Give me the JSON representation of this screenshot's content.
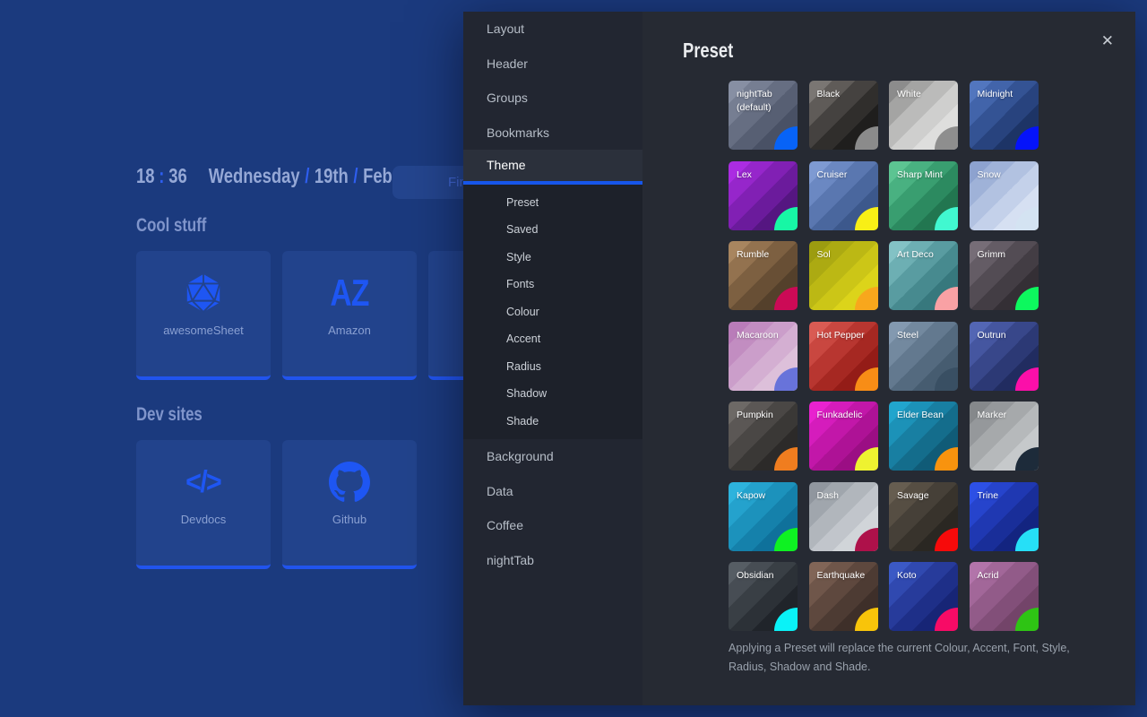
{
  "colors": {
    "page_background": "#1b3a7e",
    "page_accent": "#2154ee",
    "modal_accent": "#1656ea",
    "modal_sidebar_bg": "#222631",
    "modal_panel_bg": "#262a33"
  },
  "page": {
    "clock": {
      "hours": "18",
      "separator": ":",
      "minutes": "36",
      "day": "Wednesday",
      "date": "19th",
      "month": "February",
      "slash": "/"
    },
    "search": {
      "placeholder": "Find"
    },
    "groups": [
      {
        "title": "Cool stuff",
        "bookmarks": [
          {
            "label": "awesomeSheet",
            "icon": "d20-icon"
          },
          {
            "label": "Amazon",
            "icon": "az-letters-icon"
          },
          {
            "label": "",
            "icon": "none"
          }
        ]
      },
      {
        "title": "Dev sites",
        "bookmarks": [
          {
            "label": "Devdocs",
            "icon": "code-brackets-icon"
          },
          {
            "label": "Github",
            "icon": "github-icon"
          }
        ]
      }
    ]
  },
  "settings": {
    "menu": [
      {
        "label": "Layout"
      },
      {
        "label": "Header"
      },
      {
        "label": "Groups"
      },
      {
        "label": "Bookmarks"
      },
      {
        "label": "Theme",
        "active": true,
        "children": [
          "Preset",
          "Saved",
          "Style",
          "Fonts",
          "Colour",
          "Accent",
          "Radius",
          "Shadow",
          "Shade"
        ]
      },
      {
        "label": "Background"
      },
      {
        "label": "Data"
      },
      {
        "label": "Coffee"
      },
      {
        "label": "nightTab"
      }
    ],
    "panel": {
      "title": "Preset",
      "close_glyph": "✕",
      "note": "Applying a Preset will replace the current Colour, Accent, Font, Style, Radius, Shadow and Shade.",
      "presets": [
        {
          "name": "nightTab (default)",
          "stripes": [
            "#878fa3",
            "#767e92",
            "#666e82",
            "#575f73",
            "#495165",
            "#3c4458"
          ],
          "accent": "#0763f7"
        },
        {
          "name": "Black",
          "stripes": [
            "#7a7673",
            "#5f5b58",
            "#454240",
            "#302e2c",
            "#1f1e1d",
            "#121110"
          ],
          "accent": "#8b8b8b"
        },
        {
          "name": "White",
          "stripes": [
            "#8c8c8c",
            "#a4a4a3",
            "#bbbbba",
            "#cfcfce",
            "#dededd",
            "#ebebe9"
          ],
          "accent": "#8e8e8e"
        },
        {
          "name": "Midnight",
          "stripes": [
            "#5276be",
            "#4264aa",
            "#345394",
            "#28437e",
            "#1d3466",
            "#142850"
          ],
          "accent": "#0513fa"
        },
        {
          "name": "Lex",
          "stripes": [
            "#ab2ce2",
            "#9626cb",
            "#8120b4",
            "#6b1b9c",
            "#551681",
            "#3f1164"
          ],
          "accent": "#17f7a5"
        },
        {
          "name": "Cruiser",
          "stripes": [
            "#7e9ad2",
            "#6b88c2",
            "#5a77b0",
            "#4a679e",
            "#3c588c",
            "#2f4a7a"
          ],
          "accent": "#f8ef16"
        },
        {
          "name": "Sharp Mint",
          "stripes": [
            "#5cc492",
            "#49b181",
            "#399e70",
            "#2c8a60",
            "#227650",
            "#1a6242"
          ],
          "accent": "#41f8d0"
        },
        {
          "name": "Snow",
          "stripes": [
            "#8da2cf",
            "#9fb2d8",
            "#b2c2e1",
            "#c4d1ea",
            "#d6e0f2",
            "#e7edf8"
          ],
          "accent": "#d4e3f2"
        },
        {
          "name": "Rumble",
          "stripes": [
            "#a8855f",
            "#93724f",
            "#7d6041",
            "#684f35",
            "#54402b",
            "#413222"
          ],
          "accent": "#cc0a56"
        },
        {
          "name": "Sol",
          "stripes": [
            "#9c9c10",
            "#acaa12",
            "#bcb814",
            "#ccc617",
            "#dcd41a",
            "#ece21d"
          ],
          "accent": "#f8a71c"
        },
        {
          "name": "Art Deco",
          "stripes": [
            "#83c2c5",
            "#6dafb3",
            "#599ca1",
            "#478a8f",
            "#37787d",
            "#2a676c"
          ],
          "accent": "#f9a1a4"
        },
        {
          "name": "Grimm",
          "stripes": [
            "#766d77",
            "#645c65",
            "#534c54",
            "#433d44",
            "#342f35",
            "#262227"
          ],
          "accent": "#0df85e"
        },
        {
          "name": "Macaroon",
          "stripes": [
            "#b97cb9",
            "#c28dc1",
            "#cb9eca",
            "#d4afd2",
            "#ddc0da",
            "#e6d1e2"
          ],
          "accent": "#6873da"
        },
        {
          "name": "Hot Pepper",
          "stripes": [
            "#d95b53",
            "#c94740",
            "#b83630",
            "#a62822",
            "#941c17",
            "#82120e"
          ],
          "accent": "#f88d16"
        },
        {
          "name": "Steel",
          "stripes": [
            "#8399b0",
            "#73899f",
            "#63798f",
            "#546a7f",
            "#465c70",
            "#394e61"
          ],
          "accent": "#394f63"
        },
        {
          "name": "Outrun",
          "stripes": [
            "#5366b4",
            "#4556a0",
            "#38478a",
            "#2c3975",
            "#212c60",
            "#17204b"
          ],
          "accent": "#fb0fa9"
        },
        {
          "name": "Pumpkin",
          "stripes": [
            "#6d6966",
            "#5b5755",
            "#4a4745",
            "#3a3836",
            "#2c2a29",
            "#1f1e1d"
          ],
          "accent": "#f07d1f"
        },
        {
          "name": "Funkadelic",
          "stripes": [
            "#e822cf",
            "#d51cbc",
            "#c217a9",
            "#ae1296",
            "#9b0e84",
            "#880a72"
          ],
          "accent": "#eef230"
        },
        {
          "name": "Elder Bean",
          "stripes": [
            "#21a5cd",
            "#1c92b8",
            "#187fa2",
            "#146d8c",
            "#105b77",
            "#0c4a62"
          ],
          "accent": "#f8930e"
        },
        {
          "name": "Marker",
          "stripes": [
            "#85888b",
            "#95989b",
            "#a6a9ab",
            "#b6b9bb",
            "#c6c9cb",
            "#d6d9da"
          ],
          "accent": "#1d2b3a"
        },
        {
          "name": "Kapow",
          "stripes": [
            "#2db3dd",
            "#24a2cd",
            "#1c92bc",
            "#1581ab",
            "#0f719b",
            "#0a618a"
          ],
          "accent": "#0ef222"
        },
        {
          "name": "Dash",
          "stripes": [
            "#90969e",
            "#a0a6ad",
            "#b1b6bc",
            "#c1c5cb",
            "#d1d5d9",
            "#e1e4e7"
          ],
          "accent": "#ae114a"
        },
        {
          "name": "Savage",
          "stripes": [
            "#665d50",
            "#564e43",
            "#464038",
            "#38332c",
            "#2a2722",
            "#1e1b18"
          ],
          "accent": "#f70a0a"
        },
        {
          "name": "Trine",
          "stripes": [
            "#2d50e5",
            "#2644cc",
            "#1f38b2",
            "#192e99",
            "#132480",
            "#0e1a67"
          ],
          "accent": "#26dff7"
        },
        {
          "name": "Obsidian",
          "stripes": [
            "#565d64",
            "#474d54",
            "#393f45",
            "#2c3137",
            "#20242a",
            "#15181c"
          ],
          "accent": "#0af2f7"
        },
        {
          "name": "Earthquake",
          "stripes": [
            "#816557",
            "#6f564a",
            "#5e483e",
            "#4d3b33",
            "#3e2f29",
            "#302420"
          ],
          "accent": "#f8c40a"
        },
        {
          "name": "Koto",
          "stripes": [
            "#3b59c5",
            "#3049b0",
            "#273b9b",
            "#1e2f88",
            "#172576",
            "#111c64"
          ],
          "accent": "#f70b66"
        },
        {
          "name": "Acrid",
          "stripes": [
            "#b274aa",
            "#a26799",
            "#925b89",
            "#824f79",
            "#734469",
            "#64395a"
          ],
          "accent": "#2ec414"
        }
      ]
    }
  }
}
